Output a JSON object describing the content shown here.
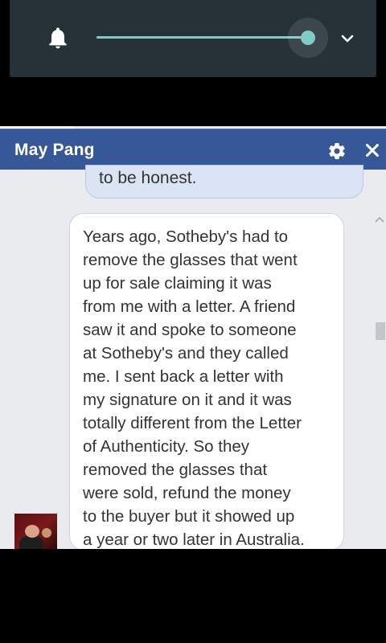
{
  "system": {
    "volume": {
      "level": 1.0,
      "accent": "#80cbc4",
      "icons": [
        "bell-icon",
        "chevron-down-icon"
      ]
    }
  },
  "chat": {
    "title": "May Pang",
    "header_color": "#365899",
    "icons": [
      "gear-icon",
      "close-icon"
    ],
    "messages": [
      {
        "text": "to be honest."
      },
      {
        "text": "Years ago, Sotheby's had to\nremove the glasses that went\nup for sale claiming it was\nfrom me with a letter. A friend\nsaw it and spoke to someone\nat Sotheby's and they called\nme.  I sent back a letter with\nmy signature on it and it was\ntotally different from the Letter\nof Authenticity.  So they\nremoved the glasses that\nwere sold, refund the money\nto the buyer but it showed up\na year or two later in Australia."
      }
    ]
  }
}
